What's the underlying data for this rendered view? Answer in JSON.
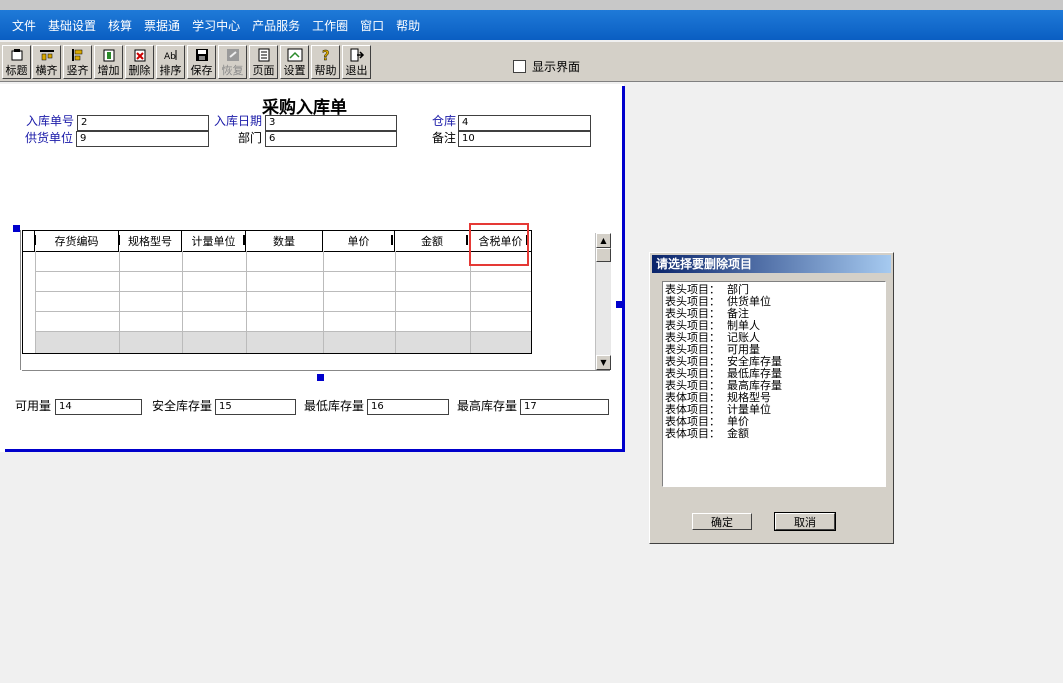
{
  "menu": [
    "文件",
    "基础设置",
    "核算",
    "票据通",
    "学习中心",
    "产品服务",
    "工作圈",
    "窗口",
    "帮助"
  ],
  "toolbar": [
    {
      "label": "标题",
      "icon": "title-icon",
      "enabled": true
    },
    {
      "label": "横齐",
      "icon": "align-horizontal-icon",
      "enabled": true
    },
    {
      "label": "竖齐",
      "icon": "align-vertical-icon",
      "enabled": true
    },
    {
      "label": "增加",
      "icon": "add-icon",
      "enabled": true
    },
    {
      "label": "删除",
      "icon": "delete-icon",
      "enabled": true
    },
    {
      "label": "排序",
      "icon": "sort-icon",
      "enabled": true
    },
    {
      "label": "保存",
      "icon": "save-icon",
      "enabled": true
    },
    {
      "label": "恢复",
      "icon": "restore-icon",
      "enabled": false
    },
    {
      "label": "页面",
      "icon": "page-icon",
      "enabled": true
    },
    {
      "label": "设置",
      "icon": "settings-icon",
      "enabled": true
    },
    {
      "label": "帮助",
      "icon": "help-icon",
      "enabled": true
    },
    {
      "label": "退出",
      "icon": "exit-icon",
      "enabled": true
    }
  ],
  "show_ui_label": "显示界面",
  "form": {
    "title": "采购入库单",
    "fields": {
      "order_no": {
        "label": "入库单号",
        "value": "2"
      },
      "date": {
        "label": "入库日期",
        "value": "3"
      },
      "warehouse": {
        "label": "仓库",
        "value": "4"
      },
      "supplier": {
        "label": "供货单位",
        "value": "9"
      },
      "dept": {
        "label": "部门",
        "value": "6"
      },
      "remark": {
        "label": "备注",
        "value": "10"
      },
      "available": {
        "label": "可用量",
        "value": "14"
      },
      "safety": {
        "label": "安全库存量",
        "value": "15"
      },
      "min_stock": {
        "label": "最低库存量",
        "value": "16"
      },
      "max_stock": {
        "label": "最高库存量",
        "value": "17"
      }
    },
    "grid_columns": [
      "存货编码",
      "规格型号",
      "计量单位",
      "数量",
      "单价",
      "金额",
      "含税单价"
    ]
  },
  "dialog": {
    "title": "请选择要删除项目",
    "items": [
      "表头项目：  部门",
      "表头项目：  供货单位",
      "表头项目：  备注",
      "表头项目：  制单人",
      "表头项目：  记账人",
      "表头项目：  可用量",
      "表头项目：  安全库存量",
      "表头项目：  最低库存量",
      "表头项目：  最高库存量",
      "表体项目：  规格型号",
      "表体项目：  计量单位",
      "表体项目：  单价",
      "表体项目：  金额"
    ],
    "ok": "确定",
    "cancel": "取消"
  },
  "colors": {
    "menubar": "#0a5ec2",
    "selection_blue": "#0000cc",
    "highlight": "#e53935"
  }
}
